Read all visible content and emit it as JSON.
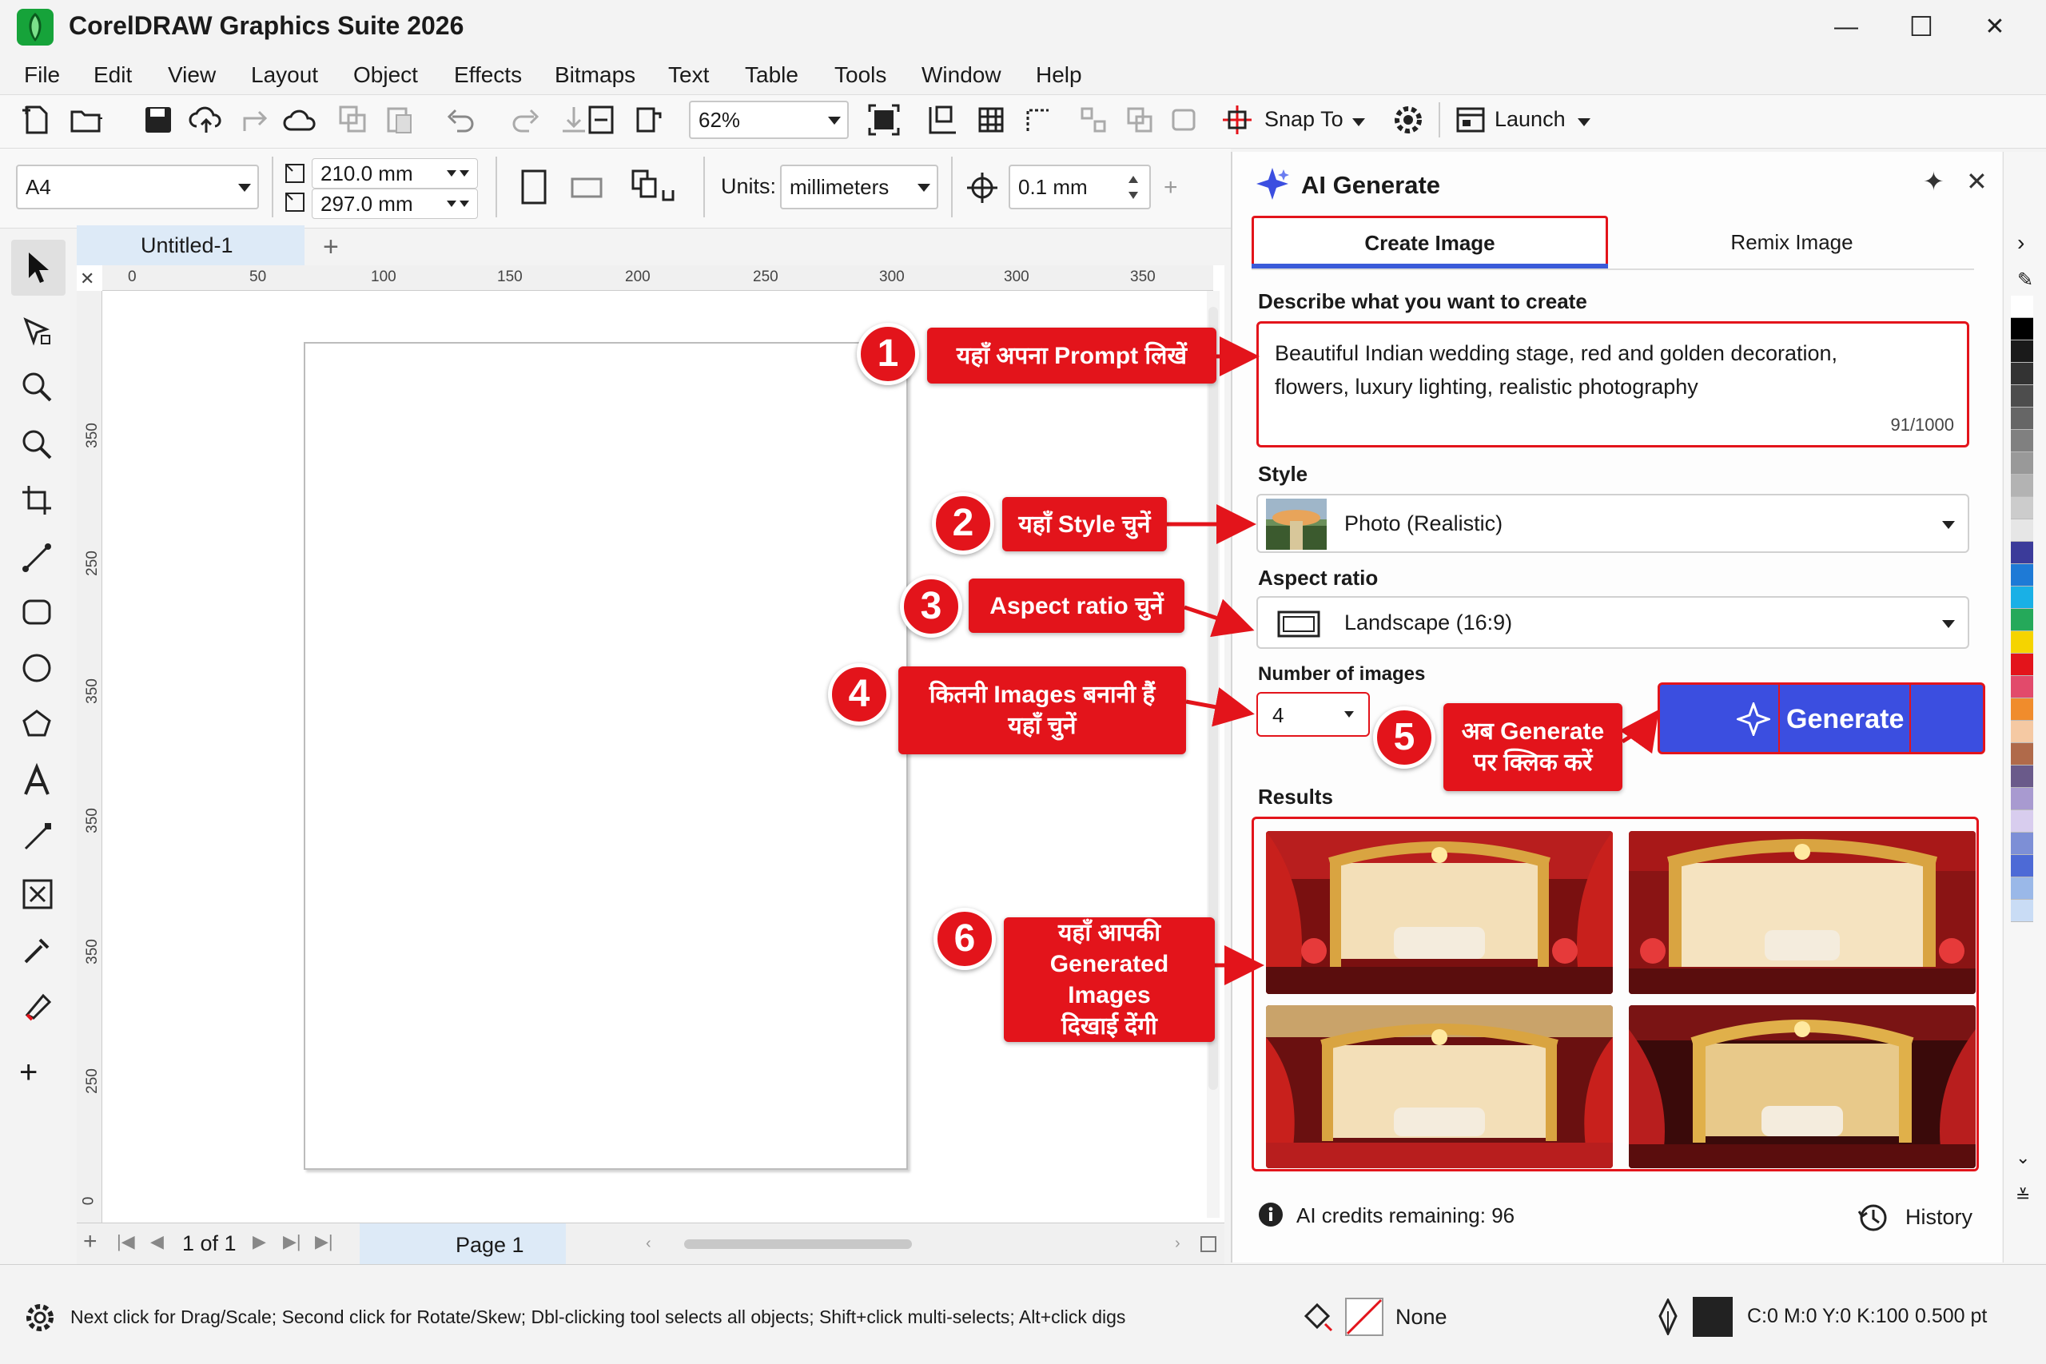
{
  "app": {
    "title": "CorelDRAW Graphics Suite 2026"
  },
  "window_controls": {
    "minimize": "—",
    "maximize": "☐",
    "close": "✕"
  },
  "menu": [
    "File",
    "Edit",
    "View",
    "Layout",
    "Object",
    "Effects",
    "Bitmaps",
    "Text",
    "Table",
    "Tools",
    "Window",
    "Help"
  ],
  "toolbar": {
    "zoom_value": "62%",
    "snap_label": "Snap To",
    "launch_label": "Launch"
  },
  "property_bar": {
    "page_size": "A4",
    "width": "210.0 mm",
    "height": "297.0 mm",
    "units_label": "Units:",
    "units_value": "millimeters",
    "nudge_value": "0.1 mm"
  },
  "document": {
    "tab_title": "Untitled-1",
    "add_tab": "+"
  },
  "rulers": {
    "top": [
      "0",
      "50",
      "100",
      "150",
      "200",
      "250",
      "300",
      "300",
      "350"
    ],
    "left": [
      "350",
      "250",
      "350",
      "350",
      "350",
      "250",
      "0"
    ]
  },
  "page_nav": {
    "count": "1 of 1",
    "page_tab": "Page 1"
  },
  "status": {
    "hint": "Next click for Drag/Scale; Second click for Rotate/Skew; Dbl-clicking tool selects all objects; Shift+click multi-selects; Alt+click digs",
    "fill_label": "None",
    "color_readout": "C:0 M:0 Y:0 K:100",
    "outline_width": "0.500 pt"
  },
  "ai_panel": {
    "title": "AI Generate",
    "tabs": [
      {
        "label": "Create Image",
        "active": true
      },
      {
        "label": "Remix Image",
        "active": false
      }
    ],
    "prompt_label": "Describe what you want to create",
    "prompt_line1": "Beautiful Indian wedding stage, red and golden decoration,",
    "prompt_line2": "flowers, luxury lighting, realistic photography",
    "char_count": "91/1000",
    "style_label": "Style",
    "style_value": "Photo (Realistic)",
    "aspect_label": "Aspect ratio",
    "aspect_value": "Landscape (16:9)",
    "num_label": "Number of images",
    "num_value": "4",
    "generate_label": "Generate",
    "results_label": "Results",
    "credits": "AI credits remaining: 96",
    "history_label": "History"
  },
  "annotations": [
    {
      "num": "1",
      "text": "यहाँ अपना Prompt लिखें"
    },
    {
      "num": "2",
      "text": "यहाँ Style चुनें"
    },
    {
      "num": "3",
      "text": "Aspect ratio चुनें"
    },
    {
      "num": "4",
      "line1": "कितनी Images बनानी हैं",
      "line2": "यहाँ चुनें"
    },
    {
      "num": "5",
      "line1": "अब Generate",
      "line2": "पर क्लिक करें"
    },
    {
      "num": "6",
      "line1": "यहाँ आपकी",
      "line2": "Generated Images",
      "line3": "दिखाई देंगी"
    }
  ],
  "colors": {
    "accent_red": "#e3141b",
    "generate_blue": "#3b4ee0",
    "tab_underline": "#3a5bd9"
  },
  "palette": [
    "#ffffff",
    "#000000",
    "#1a1a1a",
    "#333333",
    "#4d4d4d",
    "#666666",
    "#808080",
    "#999999",
    "#b3b3b3",
    "#cccccc",
    "#e6e6e6",
    "#3b3b9a",
    "#1e7ad6",
    "#19b0e6",
    "#25a95a",
    "#f5d400",
    "#e3141b",
    "#e24a6b",
    "#f08c2c",
    "#f5c9a3",
    "#b06a4a",
    "#6a5a8a",
    "#a89ad0",
    "#d8cdee",
    "#7d8fd6",
    "#4d6ad6",
    "#9ab8e8",
    "#c9dcf5"
  ]
}
